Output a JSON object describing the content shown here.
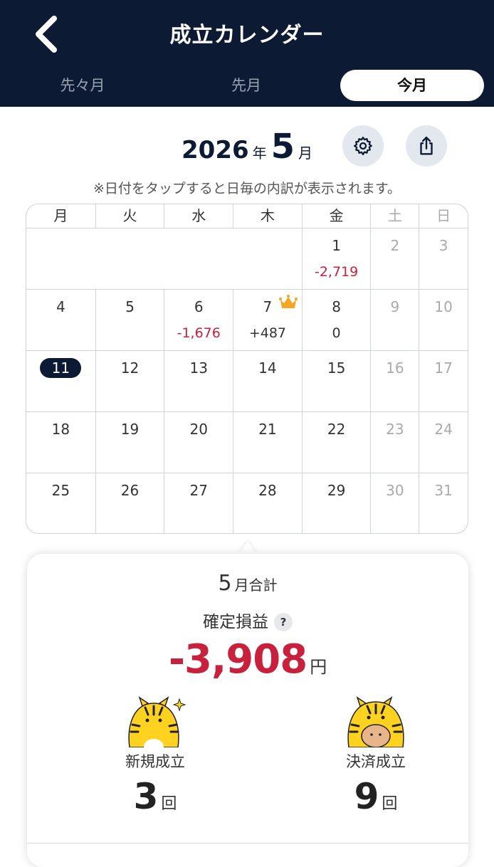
{
  "header": {
    "title": "成立カレンダー",
    "tabs": [
      {
        "label": "先々月",
        "active": false
      },
      {
        "label": "先月",
        "active": false
      },
      {
        "label": "今月",
        "active": true
      }
    ]
  },
  "month_view": {
    "year": "2026",
    "year_unit": "年",
    "month": "5",
    "month_unit": "月",
    "hint": "※日付をタップすると日毎の内訳が表示されます。"
  },
  "calendar": {
    "weekdays": [
      "月",
      "火",
      "水",
      "木",
      "金",
      "土",
      "日"
    ],
    "today": "11",
    "weeks": [
      [
        null,
        null,
        null,
        null,
        {
          "day": "1",
          "pl": "-2,719",
          "neg": true
        },
        {
          "day": "2"
        },
        {
          "day": "3"
        }
      ],
      [
        {
          "day": "4"
        },
        {
          "day": "5"
        },
        {
          "day": "6",
          "pl": "-1,676",
          "neg": true
        },
        {
          "day": "7",
          "pl": "+487",
          "crown": true
        },
        {
          "day": "8",
          "pl": "0"
        },
        {
          "day": "9"
        },
        {
          "day": "10"
        }
      ],
      [
        {
          "day": "11"
        },
        {
          "day": "12"
        },
        {
          "day": "13"
        },
        {
          "day": "14"
        },
        {
          "day": "15"
        },
        {
          "day": "16"
        },
        {
          "day": "17"
        }
      ],
      [
        {
          "day": "18"
        },
        {
          "day": "19"
        },
        {
          "day": "20"
        },
        {
          "day": "21"
        },
        {
          "day": "22"
        },
        {
          "day": "23"
        },
        {
          "day": "24"
        }
      ],
      [
        {
          "day": "25"
        },
        {
          "day": "26"
        },
        {
          "day": "27"
        },
        {
          "day": "28"
        },
        {
          "day": "29"
        },
        {
          "day": "30"
        },
        {
          "day": "31"
        }
      ]
    ]
  },
  "summary": {
    "month": "5",
    "title_suffix": "月合計",
    "label": "確定損益",
    "help": "?",
    "total": "-3,908",
    "currency": "円",
    "new_label": "新規成立",
    "new_count": "3",
    "close_label": "決済成立",
    "close_count": "9",
    "count_unit": "回"
  },
  "colors": {
    "header_bg": "#0c1a33",
    "negative": "#c8213d",
    "crown": "#f5a623",
    "mascot": "#ffd21f"
  },
  "icons": {
    "back": "chevron-left-icon",
    "settings": "gear-icon",
    "share": "share-icon",
    "crown": "crown-icon"
  }
}
